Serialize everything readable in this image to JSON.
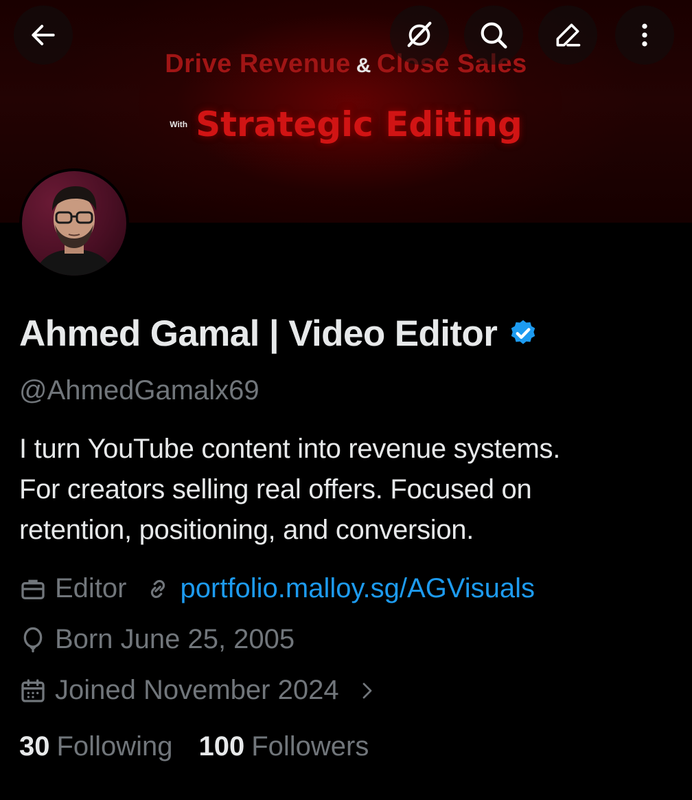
{
  "banner": {
    "line1_part1": "Drive Revenue",
    "line1_amp": "&",
    "line1_part2": "Close Sales",
    "with": "With",
    "line2": "Strategic Editing"
  },
  "top_bar": {
    "back_icon": "arrow-left-icon",
    "grok_icon": "grok-icon",
    "search_icon": "search-icon",
    "edit_icon": "edit-pencil-icon",
    "more_icon": "more-vertical-icon"
  },
  "profile": {
    "name": "Ahmed Gamal | Video Editor",
    "verified": true,
    "handle": "@AhmedGamalx69",
    "bio": [
      "I turn YouTube content into revenue systems.",
      "For creators selling real offers. Focused on",
      "retention, positioning, and conversion."
    ],
    "category": "Editor",
    "website": "portfolio.malloy.sg/AGVisuals",
    "birthday": "Born June 25, 2005",
    "joined": "Joined November 2024",
    "following_count": "30",
    "following_label": "Following",
    "followers_count": "100",
    "followers_label": "Followers"
  },
  "colors": {
    "background": "#000000",
    "text_primary": "#e7e9ea",
    "text_secondary": "#71767b",
    "link": "#1d9bf0",
    "verified": "#1d9bf0",
    "banner_red": "#d11414"
  }
}
